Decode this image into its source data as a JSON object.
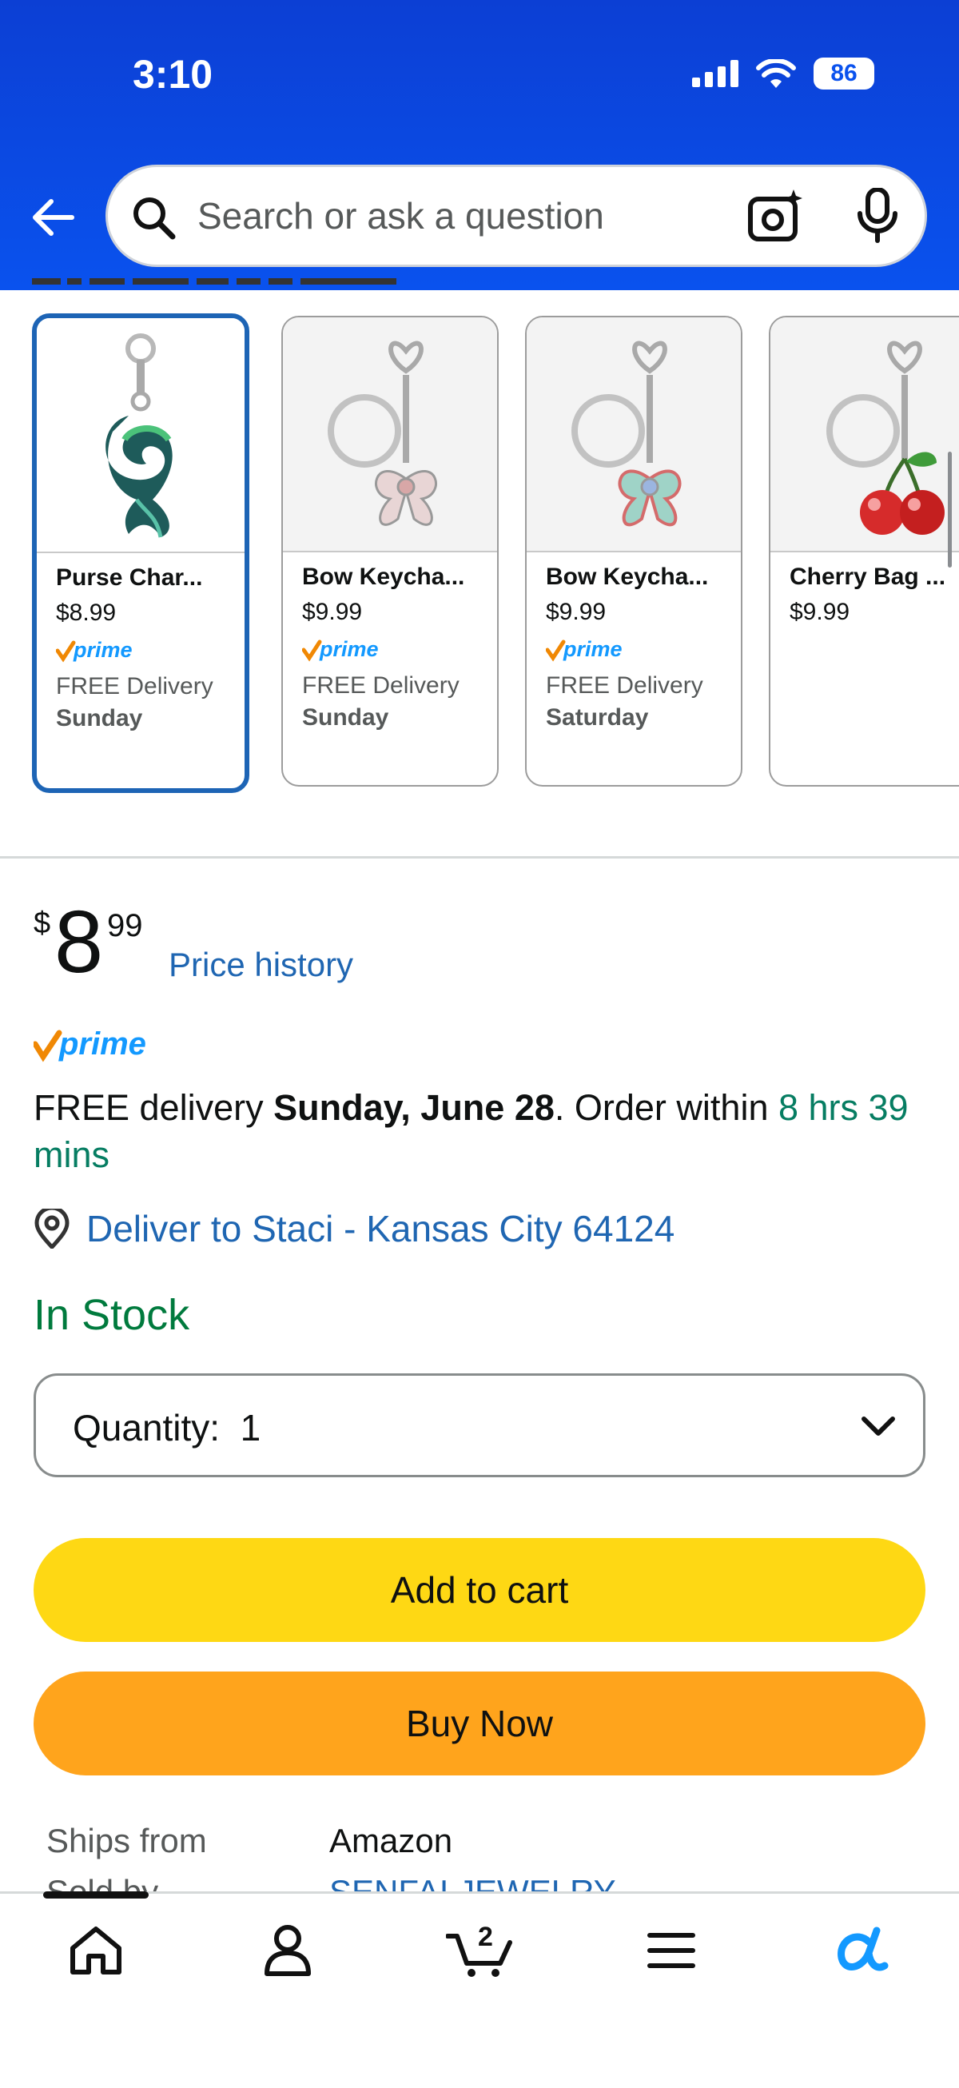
{
  "status_bar": {
    "time": "3:10",
    "battery": "86"
  },
  "search": {
    "placeholder": "Search or ask a question"
  },
  "related_products": [
    {
      "title": "Purse Char...",
      "price": "$8.99",
      "prime": "prime",
      "delivery": "FREE Delivery",
      "day": "Sunday",
      "selected": true
    },
    {
      "title": "Bow Keycha...",
      "price": "$9.99",
      "prime": "prime",
      "delivery": "FREE Delivery",
      "day": "Sunday"
    },
    {
      "title": "Bow Keycha...",
      "price": "$9.99",
      "prime": "prime",
      "delivery": "FREE Delivery",
      "day": "Saturday"
    },
    {
      "title": "Cherry Bag ...",
      "price": "$9.99"
    }
  ],
  "price": {
    "symbol": "$",
    "whole": "8",
    "fraction": "99",
    "history_link": "Price history"
  },
  "prime_label": "prime",
  "delivery": {
    "prefix": "FREE delivery ",
    "date": "Sunday, June 28",
    "middle": ". Order within ",
    "countdown": "8 hrs 39 mins"
  },
  "deliver_to": "Deliver to Staci - Kansas City 64124",
  "stock_status": "In Stock",
  "quantity": {
    "label": "Quantity:",
    "value": "1"
  },
  "buttons": {
    "add_to_cart": "Add to cart",
    "buy_now": "Buy Now"
  },
  "ships_from": {
    "label": "Ships from",
    "value": "Amazon"
  },
  "sold_by": {
    "label": "Sold by",
    "value": "SENFAI JEWELRY"
  },
  "tabbar": {
    "cart_count": "2"
  },
  "colors": {
    "header": "#0a52ee",
    "link": "#1f66b2",
    "add_to_cart": "#fed814",
    "buy_now": "#ffa41c",
    "in_stock": "#007a3d",
    "prime": "#1399ff"
  }
}
